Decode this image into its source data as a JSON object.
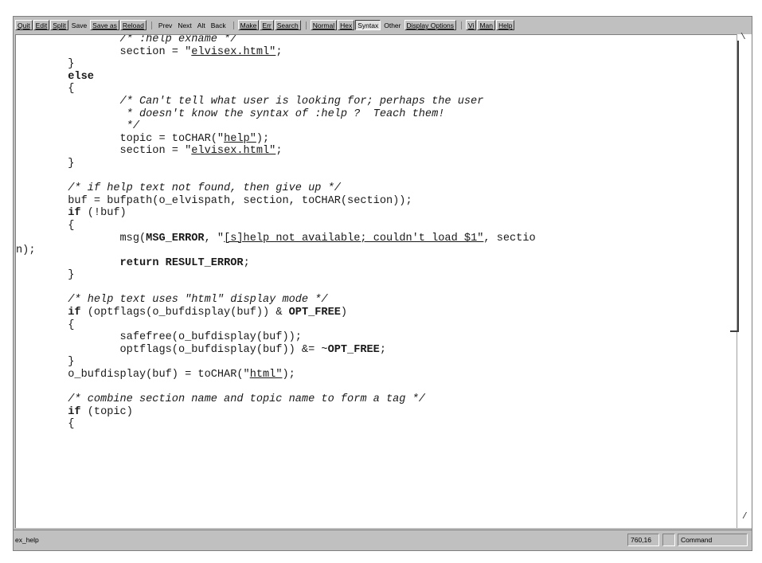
{
  "toolbar": {
    "group1": [
      "Quit",
      "Edit",
      "Split",
      "Save",
      "Save as",
      "Reload"
    ],
    "group2": [
      "Prev",
      "Next",
      "Alt",
      "Back"
    ],
    "group3": [
      "Make",
      "Err",
      "Search"
    ],
    "group4": [
      "Normal",
      "Hex",
      "Syntax",
      "Other",
      "Display Options"
    ],
    "group5": [
      "Vi",
      "Man",
      "Help"
    ]
  },
  "code_lines": [
    "                /* :help exname */",
    "                section = \"elvisex.html\";",
    "        }",
    "        else",
    "        {",
    "                /* Can't tell what user is looking for; perhaps the user",
    "                 * doesn't know the syntax of :help ?  Teach them!",
    "                 */",
    "                topic = toCHAR(\"help\");",
    "                section = \"elvisex.html\";",
    "        }",
    "",
    "        /* if help text not found, then give up */",
    "        buf = bufpath(o_elvispath, section, toCHAR(section));",
    "        if (!buf)",
    "        {",
    "                msg(MSG_ERROR, \"[s]help not available; couldn't load $1\", sectio",
    "n);",
    "                return RESULT_ERROR;",
    "        }",
    "",
    "        /* help text uses \"html\" display mode */",
    "        if (optflags(o_bufdisplay(buf)) & OPT_FREE)",
    "        {",
    "                safefree(o_bufdisplay(buf));",
    "                optflags(o_bufdisplay(buf)) &= ~OPT_FREE;",
    "        }",
    "        o_bufdisplay(buf) = toCHAR(\"html\");",
    "",
    "        /* combine section name and topic name to form a tag */",
    "        if (topic)",
    "        {"
  ],
  "statusbar": {
    "buffer_name": "ex_help",
    "position": "760,16",
    "mode": "Command"
  }
}
